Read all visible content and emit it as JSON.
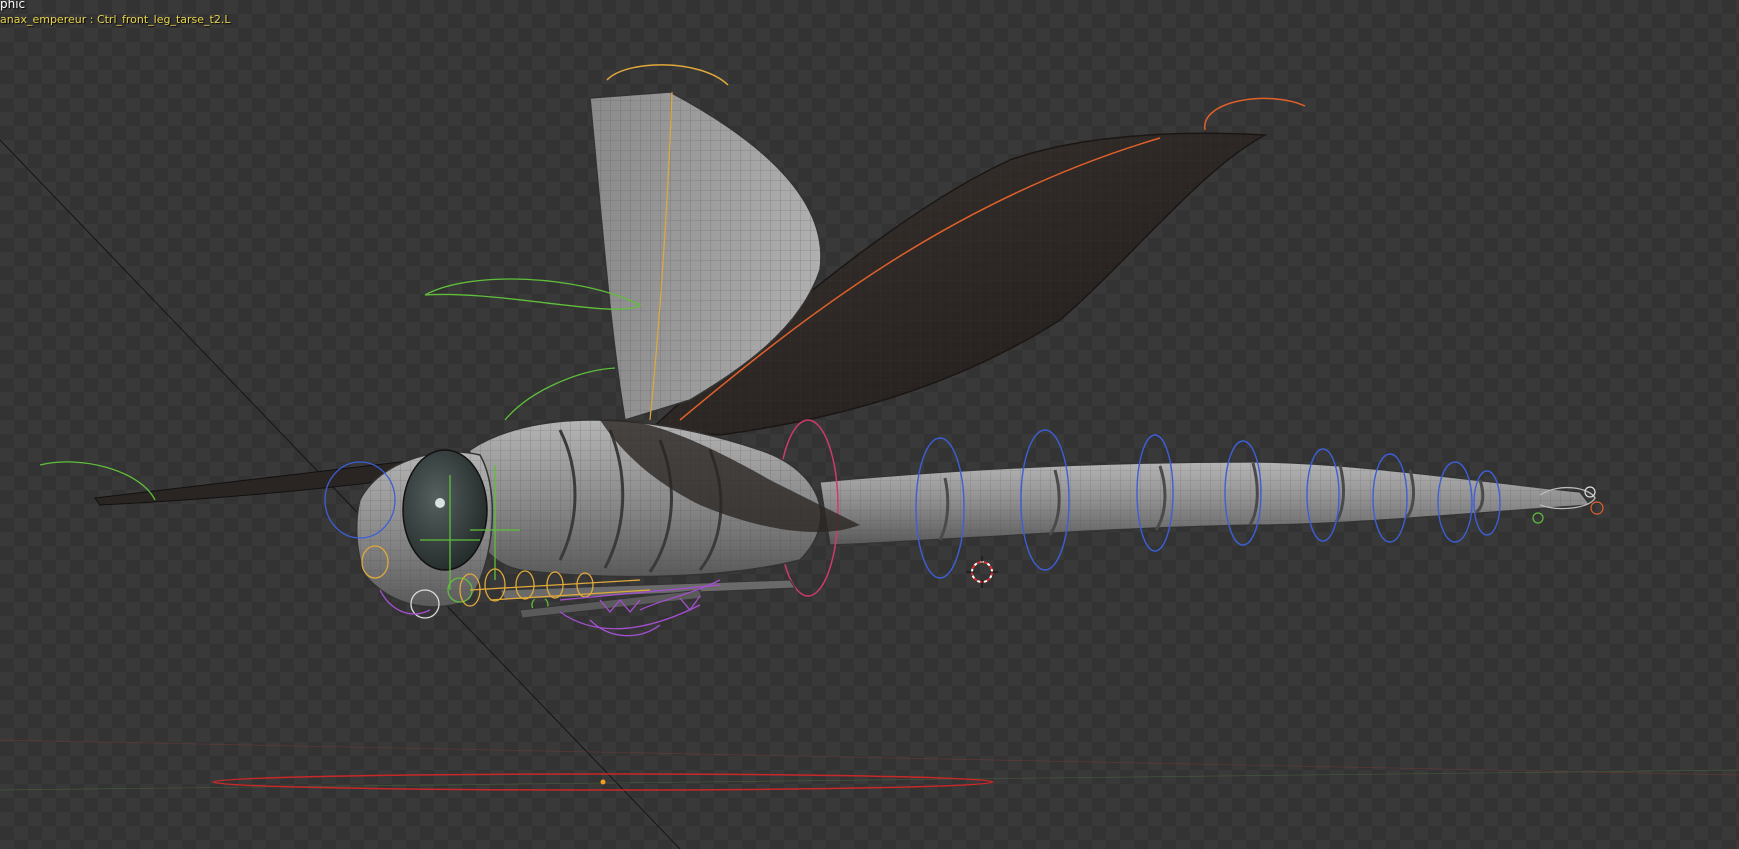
{
  "viewport": {
    "view_label": "phic",
    "object_label": "anax_empereur : Ctrl_front_leg_tarse_t2.L"
  },
  "colors": {
    "background": "#393939",
    "checker": "#333333",
    "object_label": "#e8d24a",
    "mesh": "#9a9a9a",
    "wing_dark": "#2a2522",
    "bone_green": "#5fbf3a",
    "bone_blue": "#3c5fd6",
    "bone_yellow": "#e0a93a",
    "bone_purple": "#a44fd0",
    "bone_orange": "#e0602a",
    "bone_pink": "#d03a6a",
    "root_red": "#c82828"
  },
  "icons": {
    "cursor": "3d-cursor-icon",
    "model": "dragonfly-rig"
  }
}
